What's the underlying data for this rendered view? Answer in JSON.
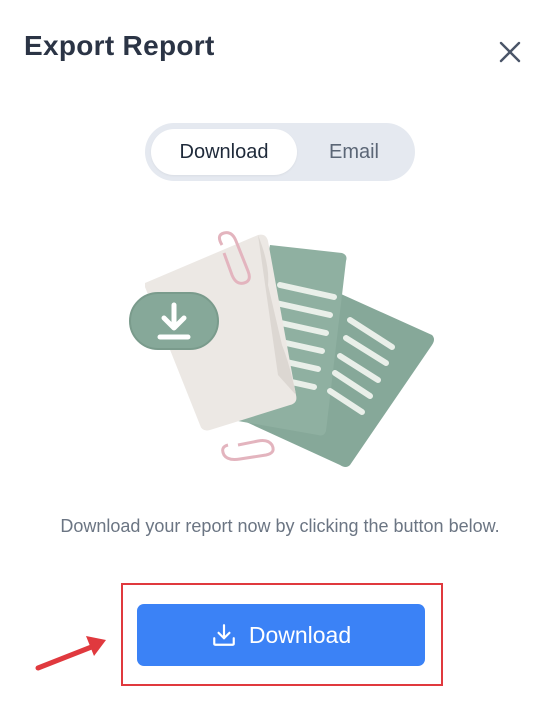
{
  "dialog": {
    "title": "Export Report",
    "close_icon": "close-icon"
  },
  "tabs": [
    {
      "label": "Download",
      "active": true
    },
    {
      "label": "Email",
      "active": false
    }
  ],
  "illustration": {
    "icons": [
      "download-icon",
      "paperclip-icon",
      "document-icon"
    ],
    "colors": {
      "sheet": "#ece8e4",
      "green": "#86a899",
      "clip": "#e3b4be"
    }
  },
  "description": "Download your report now by clicking the button below.",
  "download_button": {
    "label": "Download",
    "icon": "download-icon",
    "color": "#3b82f6"
  },
  "annotation": {
    "highlight_color": "#e0393e",
    "arrow_color": "#e0393e"
  }
}
